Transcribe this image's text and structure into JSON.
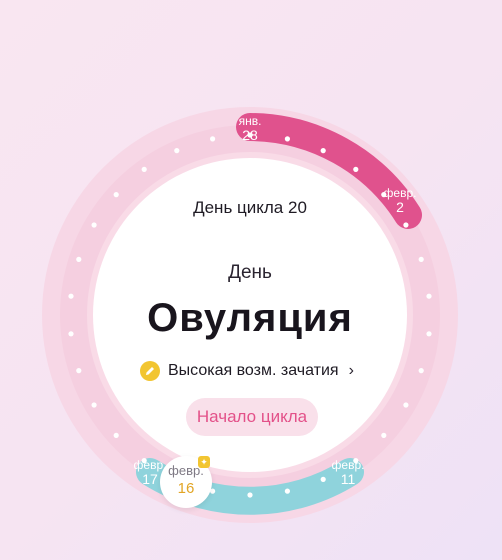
{
  "center": {
    "cycle_day": "День цикла 20",
    "day_label": "День",
    "phase_title": "Овуляция",
    "fertility_text": "Высокая возм. зачатия",
    "chevron": "›",
    "start_button": "Начало цикла"
  },
  "ring": {
    "period_start": {
      "month": "янв.",
      "day": "28"
    },
    "period_end": {
      "month": "февр.",
      "day": "2"
    },
    "fertile_start": {
      "month": "февр.",
      "day": "17"
    },
    "fertile_end": {
      "month": "февр.",
      "day": "11"
    },
    "today": {
      "month": "февр.",
      "day": "16"
    }
  },
  "colors": {
    "period_arc": "#e0528d",
    "fertile_arc": "#8fd3dc",
    "accent_yellow": "#f2c531",
    "button_text": "#e35189"
  },
  "icons": {
    "fertility": "pencil-icon",
    "today_marker": "ovulation-flag-icon"
  }
}
